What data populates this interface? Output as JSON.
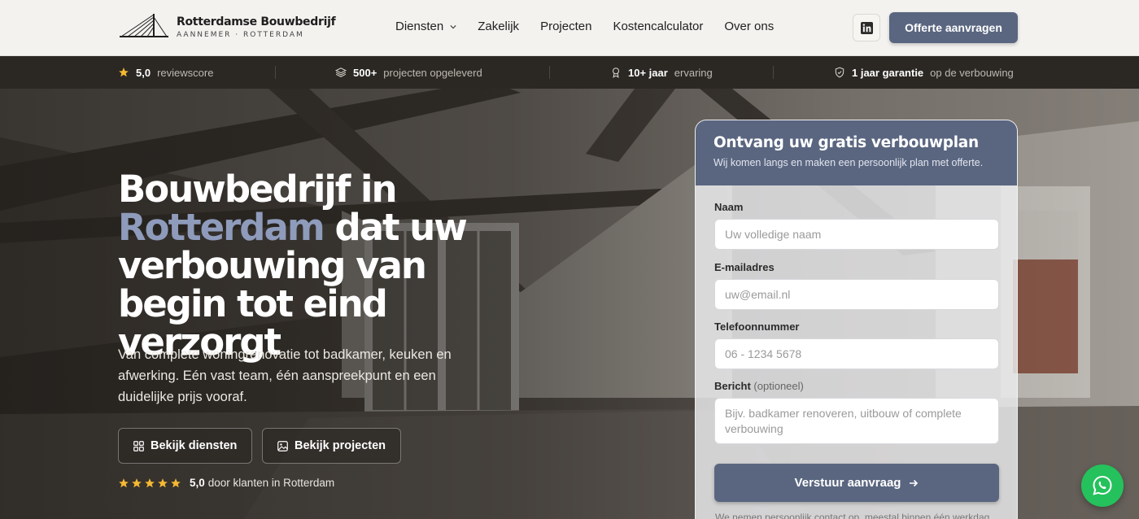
{
  "header": {
    "logo_title": "Rotterdamse Bouwbedrijf",
    "logo_subtitle": "AANNEMER · ROTTERDAM",
    "nav": [
      {
        "label": "Diensten",
        "dropdown": true
      },
      {
        "label": "Zakelijk"
      },
      {
        "label": "Projecten"
      },
      {
        "label": "Kostencalculator"
      },
      {
        "label": "Over ons"
      }
    ],
    "social_icon": "linkedin-icon",
    "cta_label": "Offerte aanvragen"
  },
  "stats": [
    {
      "icon": "star-icon",
      "value": "5,0",
      "text": "reviewscore"
    },
    {
      "icon": "layers-icon",
      "value": "500+",
      "text": "projecten opgeleverd"
    },
    {
      "icon": "award-icon",
      "value": "10+ jaar",
      "text": "ervaring"
    },
    {
      "icon": "shield-check-icon",
      "value": "1 jaar garantie",
      "text": "op de verbouwing"
    }
  ],
  "hero": {
    "title_line1": "Bouwbedrijf in",
    "title_accent": "Rotterdam",
    "title_rest": " dat uw verbouwing van begin tot eind verzorgt",
    "lead": "Van complete woningrenovatie tot badkamer, keuken en afwerking. Eén vast team, één aanspreekpunt en een duidelijke prijs vooraf.",
    "btn_services": "Bekijk diensten",
    "btn_projects": "Bekijk projecten",
    "rating_stars": 5,
    "rating_value": "5,0",
    "rating_text": "door klanten in Rotterdam"
  },
  "form": {
    "title": "Ontvang uw gratis verbouwplan",
    "subtitle": "Wij komen langs en maken een persoonlijk plan met offerte.",
    "name_label": "Naam",
    "name_placeholder": "Uw volledige naam",
    "email_label": "E-mailadres",
    "email_placeholder": "uw@email.nl",
    "phone_label": "Telefoonnummer",
    "phone_placeholder": "06 - 1234 5678",
    "message_label": "Bericht",
    "message_optional": "(optioneel)",
    "message_placeholder": "Bijv. badkamer renoveren, uitbouw of complete verbouwing",
    "submit_label": "Verstuur aanvraag",
    "footnote": "We nemen persoonlijk contact op, meestal binnen één werkdag."
  },
  "colors": {
    "accent": "#5a6680",
    "accent_light": "#8e9bbb",
    "whatsapp": "#25c15c",
    "star": "#f5b932"
  }
}
